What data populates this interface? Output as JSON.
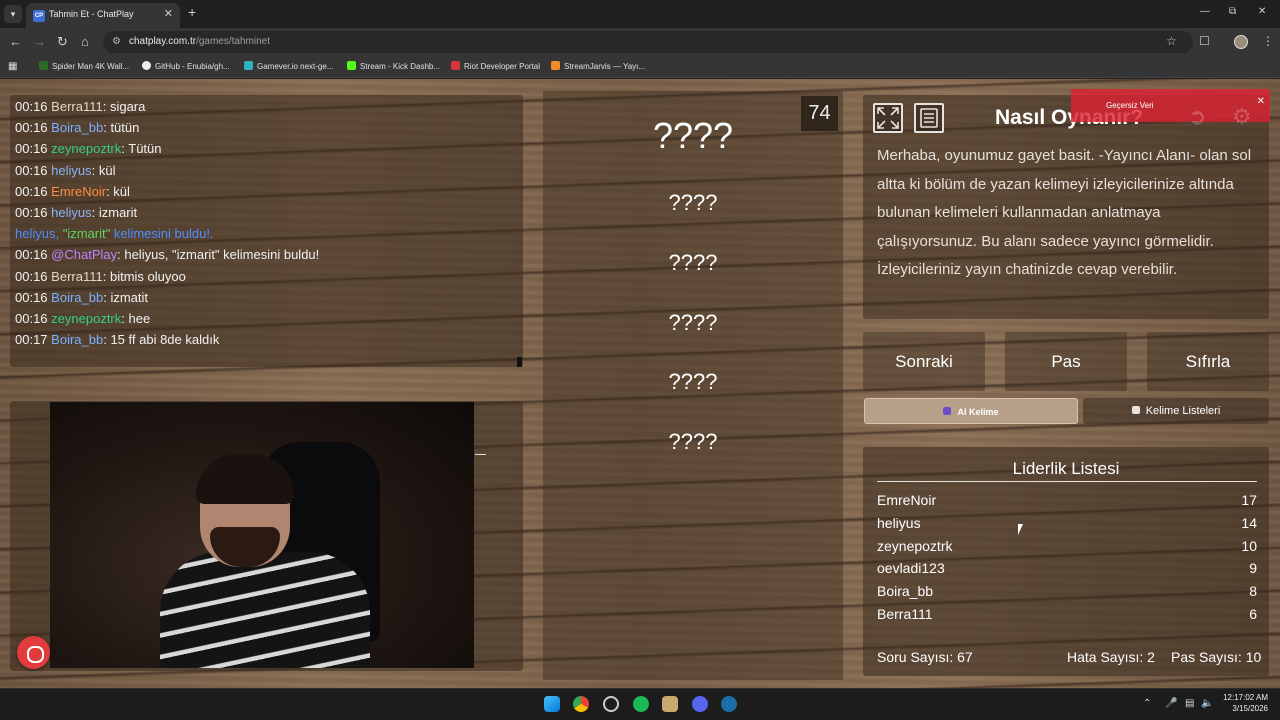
{
  "browser": {
    "tab_title": "Tahmin Et - ChatPlay",
    "tab_favicon": "CP",
    "url_host": "chatplay.com.tr",
    "url_path": "/games/tahminet",
    "bookmarks": [
      "Spider Man 4K Wall...",
      "GitHub - Enubia/gh...",
      "Gamever.io next-ge...",
      "Stream - Kick Dashb...",
      "Riot Developer Portal",
      "StreamJarvis — Yayı..."
    ]
  },
  "chat": {
    "messages": [
      {
        "time": "00:16",
        "user": "Berra111",
        "text": ": sigara"
      },
      {
        "time": "00:16",
        "user": "Boira_bb",
        "text": ": tütün"
      },
      {
        "time": "00:16",
        "user": "zeynepoztrk",
        "text": ": Tütün"
      },
      {
        "time": "00:16",
        "user": "heliyus",
        "text": ": kül"
      },
      {
        "time": "00:16",
        "user": "EmreNoir",
        "text": ": kül"
      },
      {
        "time": "00:16",
        "user": "heliyus",
        "text": ": izmarit"
      },
      {
        "time": "00:16",
        "user": "@ChatPlay",
        "text": ": heliyus, \"izmarit\" kelimesini buldu!"
      },
      {
        "time": "00:16",
        "user": "Berra111",
        "text": ": bitmis oluyoo"
      },
      {
        "time": "00:16",
        "user": "Boira_bb",
        "text": ": izmatit"
      },
      {
        "time": "00:16",
        "user": "zeynepoztrk",
        "text": ": hee"
      },
      {
        "time": "00:17",
        "user": "Boira_bb",
        "text": ": 15 ff abi 8de kaldık"
      }
    ],
    "system": {
      "pre": "heliyus, ",
      "word": "\"izmarit\"",
      "post": " kelimesini buldu!."
    }
  },
  "game": {
    "timer": "74",
    "main_word": "????",
    "forbidden_words": [
      "????",
      "????",
      "????",
      "????",
      "????"
    ]
  },
  "howto": {
    "title": "Nasıl Oynanır?",
    "text": "Merhaba, oyunumuz gayet basit. -Yayıncı Alanı- olan sol altta ki bölüm de yazan kelimeyi izleyicilerinize altında bulunan kelimeleri kullanmadan anlatmaya çalışıyorsunuz. Bu alanı sadece yayıncı görmelidir. İzleyicileriniz yayın chatinizde cevap verebilir.",
    "toast": "Geçersiz Veri"
  },
  "controls": {
    "next": "Sonraki",
    "pass": "Pas",
    "reset": "Sıfırla",
    "ai_word": "AI Kelime",
    "word_lists": "Kelime Listeleri"
  },
  "leaderboard": {
    "title": "Liderlik Listesi",
    "rows": [
      {
        "name": "EmreNoir",
        "score": "17"
      },
      {
        "name": "heliyus",
        "score": "14"
      },
      {
        "name": "zeynepoztrk",
        "score": "10"
      },
      {
        "name": "oevladi123",
        "score": "9"
      },
      {
        "name": "Boira_bb",
        "score": "8"
      },
      {
        "name": "Berra111",
        "score": "6"
      }
    ],
    "question_count": "Soru Sayısı: 67",
    "error_count": "Hata Sayısı: 2",
    "pass_count": "Pas Sayısı: 10"
  },
  "taskbar": {
    "time": "12:17:02 AM",
    "date": "3/15/2026"
  },
  "colors": {
    "accent_red": "#e23b3b",
    "toast_red": "#dc2332",
    "system_blue": "#4f8dff",
    "highlight_green": "#5fd45f"
  }
}
